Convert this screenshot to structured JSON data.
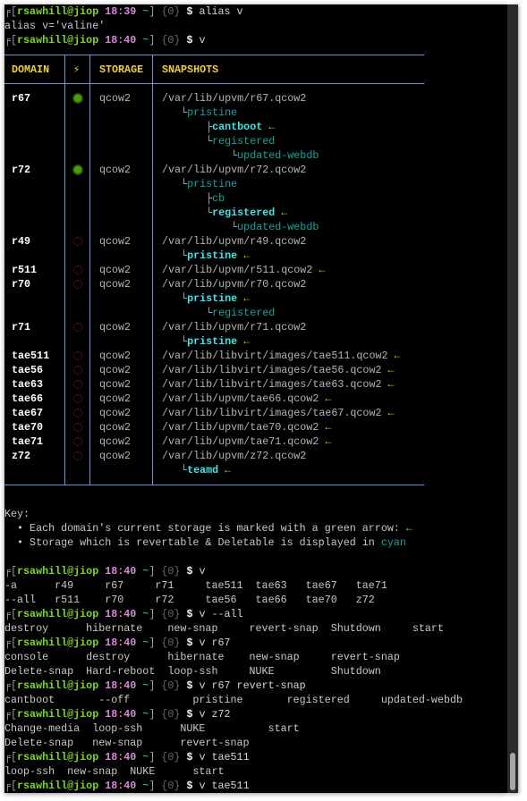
{
  "prompt": {
    "corner": "╒[",
    "user": "rsawhill@jiop",
    "tilde": "~",
    "close": "]",
    "jobs": "{0}",
    "dollar": "$"
  },
  "pre_table": [
    {
      "type": "prompt",
      "time": "18:39",
      "cmd": "alias v"
    },
    {
      "type": "out",
      "text": "alias v='valine'"
    },
    {
      "type": "prompt",
      "time": "18:40",
      "cmd": "v"
    }
  ],
  "table": {
    "headers": {
      "domain": "DOMAIN",
      "power": "⚡",
      "storage": "STORAGE",
      "snapshots": "SNAPSHOTS"
    },
    "arrow": "←",
    "colors": {
      "border": "#6f93d6",
      "header": "#f2cf3a",
      "arrow": "#8ee03a",
      "cyan": "#16a4a0",
      "bold_cyan": "#40e4e8",
      "power_on": "#4d9c10",
      "power_off": "#a0201e"
    },
    "rows": [
      {
        "domain": "r67",
        "power": "on",
        "storage": "qcow2",
        "snapshots": [
          {
            "tree": "",
            "text": "/var/lib/upvm/r67.qcow2",
            "style": "path",
            "current": false
          },
          {
            "tree": "   └",
            "text": "pristine",
            "style": "cyan",
            "current": false
          },
          {
            "tree": "       ├",
            "text": "cantboot",
            "style": "bold",
            "current": true
          },
          {
            "tree": "       └",
            "text": "registered",
            "style": "cyan",
            "current": false
          },
          {
            "tree": "           └",
            "text": "updated-webdb",
            "style": "cyan",
            "current": false
          }
        ]
      },
      {
        "domain": "r72",
        "power": "on",
        "storage": "qcow2",
        "snapshots": [
          {
            "tree": "",
            "text": "/var/lib/upvm/r72.qcow2",
            "style": "path",
            "current": false
          },
          {
            "tree": "   └",
            "text": "pristine",
            "style": "cyan",
            "current": false
          },
          {
            "tree": "       ├",
            "text": "cb",
            "style": "cyan",
            "current": false
          },
          {
            "tree": "       └",
            "text": "registered",
            "style": "bold",
            "current": true
          },
          {
            "tree": "           └",
            "text": "updated-webdb",
            "style": "cyan",
            "current": false
          }
        ]
      },
      {
        "domain": "r49",
        "power": "off",
        "storage": "qcow2",
        "snapshots": [
          {
            "tree": "",
            "text": "/var/lib/upvm/r49.qcow2",
            "style": "path",
            "current": false
          },
          {
            "tree": "   └",
            "text": "pristine",
            "style": "bold",
            "current": true
          }
        ]
      },
      {
        "domain": "r511",
        "power": "off",
        "storage": "qcow2",
        "snapshots": [
          {
            "tree": "",
            "text": "/var/lib/upvm/r511.qcow2",
            "style": "path",
            "current": true
          }
        ]
      },
      {
        "domain": "r70",
        "power": "off",
        "storage": "qcow2",
        "snapshots": [
          {
            "tree": "",
            "text": "/var/lib/upvm/r70.qcow2",
            "style": "path",
            "current": false
          },
          {
            "tree": "   └",
            "text": "pristine",
            "style": "bold",
            "current": true
          },
          {
            "tree": "       └",
            "text": "registered",
            "style": "cyan",
            "current": false
          }
        ]
      },
      {
        "domain": "r71",
        "power": "off",
        "storage": "qcow2",
        "snapshots": [
          {
            "tree": "",
            "text": "/var/lib/upvm/r71.qcow2",
            "style": "path",
            "current": false
          },
          {
            "tree": "   └",
            "text": "pristine",
            "style": "bold",
            "current": true
          }
        ]
      },
      {
        "domain": "tae511",
        "power": "off",
        "storage": "qcow2",
        "snapshots": [
          {
            "tree": "",
            "text": "/var/lib/libvirt/images/tae511.qcow2",
            "style": "path",
            "current": true
          }
        ]
      },
      {
        "domain": "tae56",
        "power": "off",
        "storage": "qcow2",
        "snapshots": [
          {
            "tree": "",
            "text": "/var/lib/libvirt/images/tae56.qcow2",
            "style": "path",
            "current": true
          }
        ]
      },
      {
        "domain": "tae63",
        "power": "off",
        "storage": "qcow2",
        "snapshots": [
          {
            "tree": "",
            "text": "/var/lib/libvirt/images/tae63.qcow2",
            "style": "path",
            "current": true
          }
        ]
      },
      {
        "domain": "tae66",
        "power": "off",
        "storage": "qcow2",
        "snapshots": [
          {
            "tree": "",
            "text": "/var/lib/upvm/tae66.qcow2",
            "style": "path",
            "current": true
          }
        ]
      },
      {
        "domain": "tae67",
        "power": "off",
        "storage": "qcow2",
        "snapshots": [
          {
            "tree": "",
            "text": "/var/lib/libvirt/images/tae67.qcow2",
            "style": "path",
            "current": true
          }
        ]
      },
      {
        "domain": "tae70",
        "power": "off",
        "storage": "qcow2",
        "snapshots": [
          {
            "tree": "",
            "text": "/var/lib/upvm/tae70.qcow2",
            "style": "path",
            "current": true
          }
        ]
      },
      {
        "domain": "tae71",
        "power": "off",
        "storage": "qcow2",
        "snapshots": [
          {
            "tree": "",
            "text": "/var/lib/upvm/tae71.qcow2",
            "style": "path",
            "current": true
          }
        ]
      },
      {
        "domain": "z72",
        "power": "off",
        "storage": "qcow2",
        "snapshots": [
          {
            "tree": "",
            "text": "/var/lib/upvm/z72.qcow2",
            "style": "path",
            "current": false
          },
          {
            "tree": "   └",
            "text": "teamd",
            "style": "bold",
            "current": true
          }
        ]
      }
    ]
  },
  "key": {
    "title": "Key:",
    "item1": "  • Each domain's current storage is marked with a green arrow: ",
    "item2": "  • Storage which is revertable & Deletable is displayed in ",
    "item2_cyan": "cyan"
  },
  "post_table": [
    {
      "type": "blank"
    },
    {
      "type": "prompt",
      "time": "18:40",
      "cmd": "v"
    },
    {
      "type": "out",
      "text": "-a      r49     r67     r71     tae511  tae63   tae67   tae71"
    },
    {
      "type": "out",
      "text": "--all   r511    r70     r72     tae56   tae66   tae70   z72"
    },
    {
      "type": "prompt",
      "time": "18:40",
      "cmd": "v --all"
    },
    {
      "type": "out",
      "text": "destroy      hibernate    new-snap     revert-snap  Shutdown     start"
    },
    {
      "type": "prompt",
      "time": "18:40",
      "cmd": "v r67"
    },
    {
      "type": "out",
      "text": "console      destroy      hibernate    new-snap     revert-snap"
    },
    {
      "type": "out",
      "text": "Delete-snap  Hard-reboot  loop-ssh     NUKE         Shutdown"
    },
    {
      "type": "prompt",
      "time": "18:40",
      "cmd": "v r67 revert-snap"
    },
    {
      "type": "out",
      "text": "cantboot       --off          pristine       registered     updated-webdb"
    },
    {
      "type": "prompt",
      "time": "18:40",
      "cmd": "v z72"
    },
    {
      "type": "out",
      "text": "Change-media  loop-ssh      NUKE          start"
    },
    {
      "type": "out",
      "text": "Delete-snap   new-snap      revert-snap"
    },
    {
      "type": "prompt",
      "time": "18:40",
      "cmd": "v tae511"
    },
    {
      "type": "out",
      "text": "loop-ssh  new-snap  NUKE      start"
    },
    {
      "type": "prompt",
      "time": "18:40",
      "cmd": "v tae511"
    }
  ]
}
